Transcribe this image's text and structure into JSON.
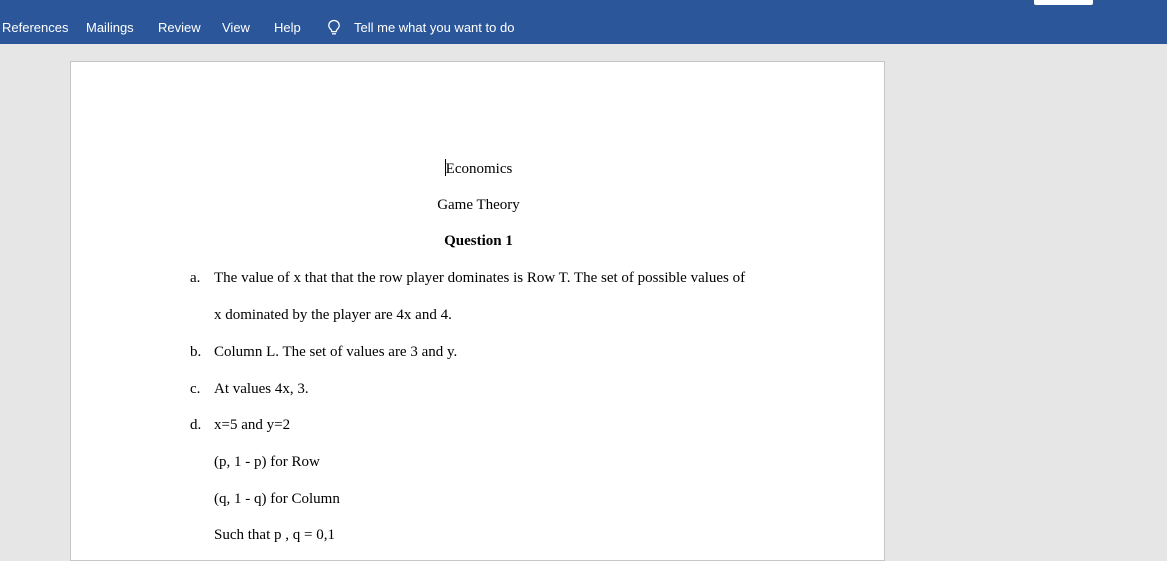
{
  "ribbon": {
    "tabs": {
      "references": "References",
      "mailings": "Mailings",
      "review": "Review",
      "view": "View",
      "help": "Help"
    },
    "tell_me": "Tell me what you want to do",
    "accent_color": "#2b579a"
  },
  "document": {
    "title": "Economics",
    "subtitle": "Game Theory",
    "heading": "Question 1",
    "items": [
      {
        "marker": "a.",
        "line1": "The value of x that that the row player dominates is Row T. The set of possible values of",
        "line2": "x dominated by the player are 4x and 4."
      },
      {
        "marker": "b.",
        "line1": "Column L. The set of values are 3 and y."
      },
      {
        "marker": "c.",
        "line1": "At values 4x, 3."
      },
      {
        "marker": "d.",
        "line1": "x=5 and y=2"
      }
    ],
    "extra_lines": [
      "(p, 1 - p) for Row",
      "(q, 1 - q) for Column",
      "Such that p , q = 0,1"
    ]
  }
}
